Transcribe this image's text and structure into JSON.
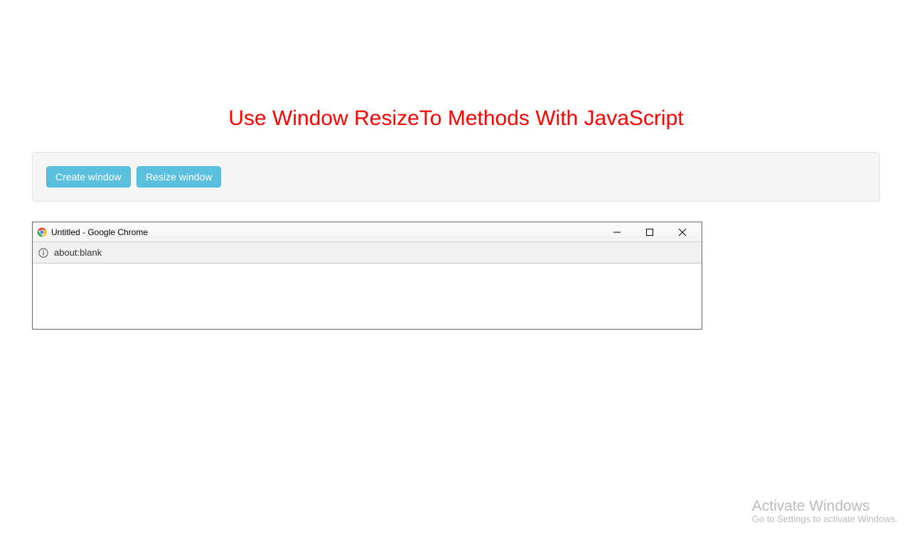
{
  "heading": "Use Window ResizeTo Methods With JavaScript",
  "buttons": {
    "create": "Create window",
    "resize": "Resize window"
  },
  "popup": {
    "title": "Untitled - Google Chrome",
    "url": "about:blank"
  },
  "watermark": {
    "title": "Activate Windows",
    "subtitle": "Go to Settings to activate Windows."
  }
}
